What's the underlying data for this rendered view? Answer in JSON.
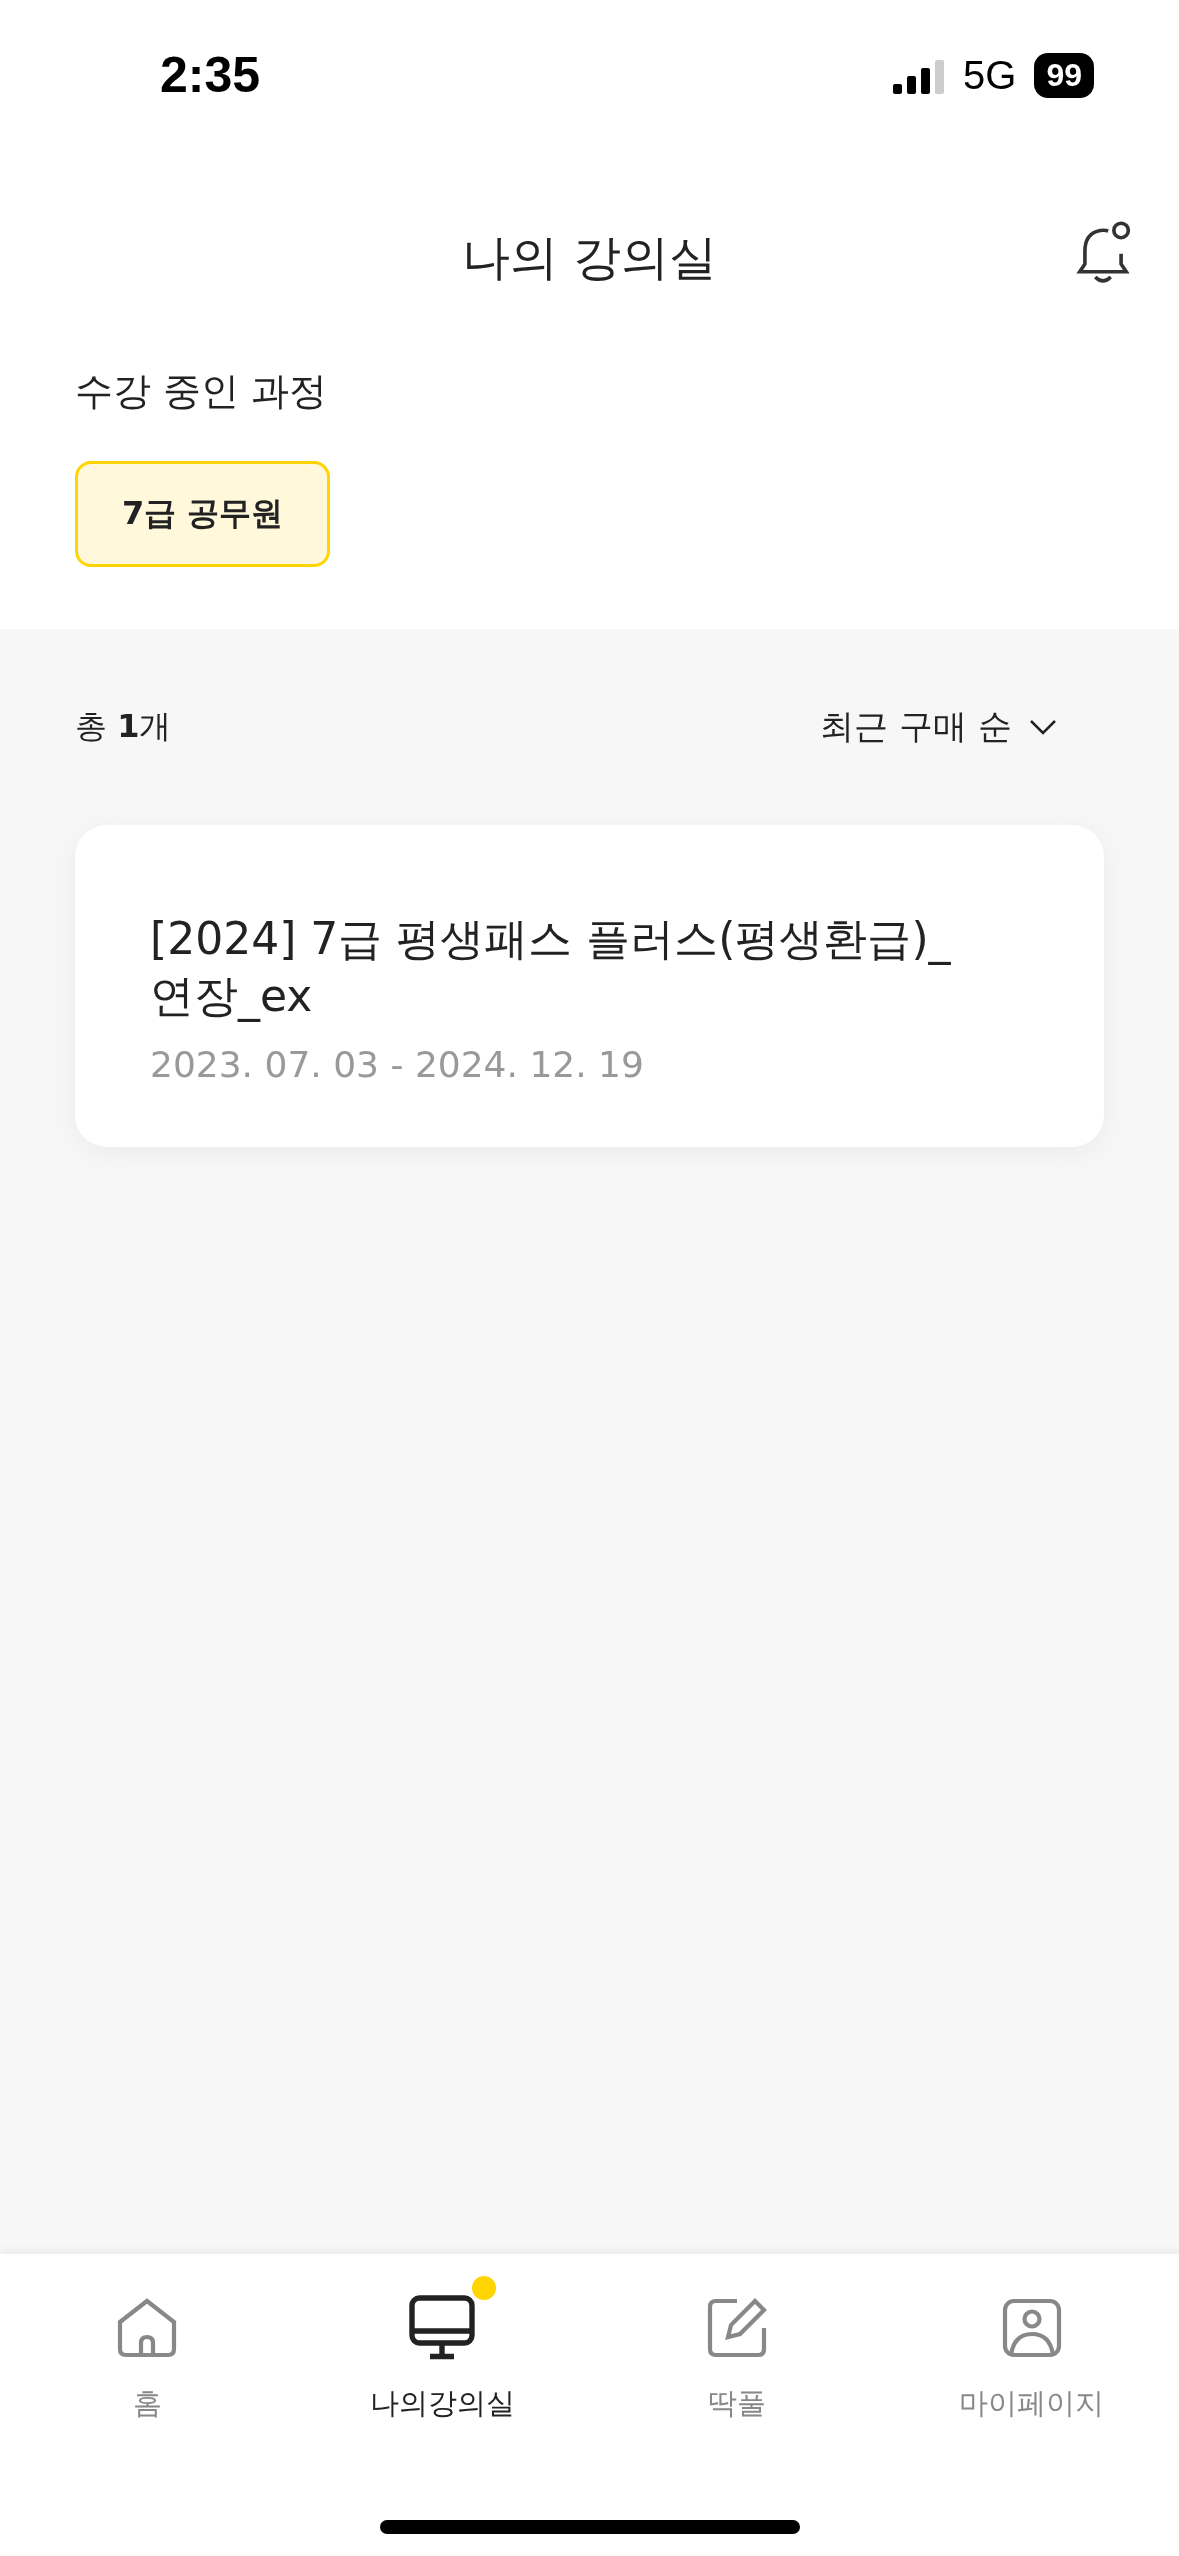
{
  "status_bar": {
    "time": "2:35",
    "network": "5G",
    "battery": "99"
  },
  "header": {
    "title": "나의 강의실"
  },
  "enrolled": {
    "heading": "수강 중인 과정",
    "chips": [
      {
        "label": "7급 공무원",
        "selected": true
      }
    ]
  },
  "list": {
    "count": "총 **1**개",
    "sort": "최근 구매 순",
    "courses": [
      {
        "title": "[2024] 7급 평생패스 플러스(평생환급)_연장_ex",
        "period": "2023. 07. 03 - 2024. 12. 19"
      }
    ]
  },
  "tab_bar": [
    {
      "kind": "home",
      "label": "홈",
      "selected": false,
      "badge": false
    },
    {
      "kind": "monitor",
      "label": "나의강의실",
      "selected": true,
      "badge": true
    },
    {
      "kind": "pencil",
      "label": "딱풀",
      "selected": false,
      "badge": false
    },
    {
      "kind": "profile",
      "label": "마이페이지",
      "selected": false,
      "badge": false
    }
  ]
}
